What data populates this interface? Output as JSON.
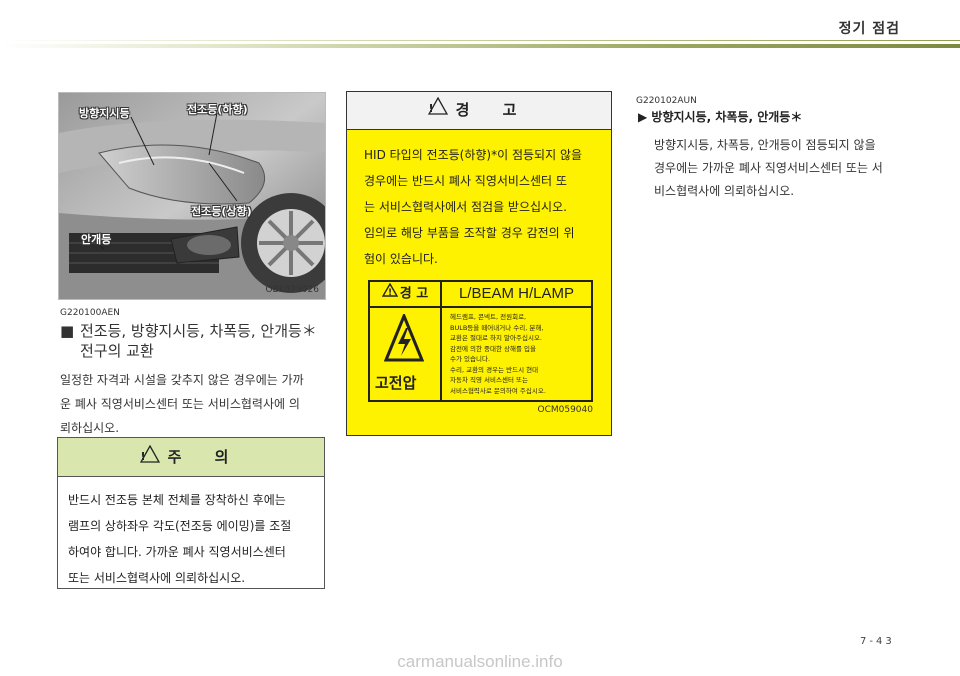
{
  "header": {
    "section_title": "정기 점검"
  },
  "photo": {
    "labels": {
      "turn_signal": "방향지시등",
      "headlamp_low": "전조등(하향)",
      "headlamp_high": "전조등(상향)",
      "fog_lamp": "안개등"
    },
    "code": "OBK079026"
  },
  "section1": {
    "code": "G220100AEN",
    "bullet": "■",
    "title_line1": "전조등, 방향지시등, 차폭등, 안개등＊",
    "title_line2": "전구의 교환",
    "body": [
      "일정한 자격과 시설을 갖추지 않은 경우에는 가까",
      "운 폐사 직영서비스센터 또는 서비스협력사에 의",
      "뢰하십시오."
    ]
  },
  "caution": {
    "title": "주 의",
    "icon_glyph": "!",
    "lines": [
      "반드시 전조등 본체 전체를 장착하신 후에는",
      "램프의 상하좌우 각도(전조등 에이밍)를 조절",
      "하여야 합니다. 가까운 폐사 직영서비스센터",
      "또는 서비스협력사에 의뢰하십시오."
    ]
  },
  "warning": {
    "title": "경 고",
    "icon_glyph": "!",
    "lines": [
      "HID 타입의 전조등(하향)*이 점등되지 않을",
      "경우에는 반드시 폐사 직영서비스센터 또",
      "는 서비스협력사에서 점검을 받으십시오.",
      "임의로 해당 부품을 조작할 경우 감전의 위",
      "험이 있습니다."
    ],
    "label": {
      "warn_word": "경 고",
      "model": "L/BEAM H/LAMP",
      "high_voltage": "고전압",
      "text_lines": [
        "헤드램프, 콘넥트, 전원회로,",
        "BULB등을 떼어내거나 수리, 분해,",
        "교환은 절대로 하지 말아주십시오.",
        "감전에 의한 중대한 상해를 입을",
        "수가 있습니다.",
        "수리, 교환의 경우는 반드시 현대",
        "자동차 직영 서비스센터 또는",
        "서비스협력사로 문의하여 주십시오."
      ]
    },
    "code": "OCM059040"
  },
  "section2": {
    "code": "G220102AUN",
    "marker": "▶",
    "title": "방향지시등, 차폭등, 안개등＊",
    "lines": [
      "방향지시등, 차폭등, 안개등이 점등되지 않을",
      "경우에는 가까운 폐사 직영서비스센터 또는 서",
      "비스협력사에 의뢰하십시오."
    ]
  },
  "footer": {
    "page_number": "7-43",
    "watermark": "carmanualsonline.info"
  }
}
